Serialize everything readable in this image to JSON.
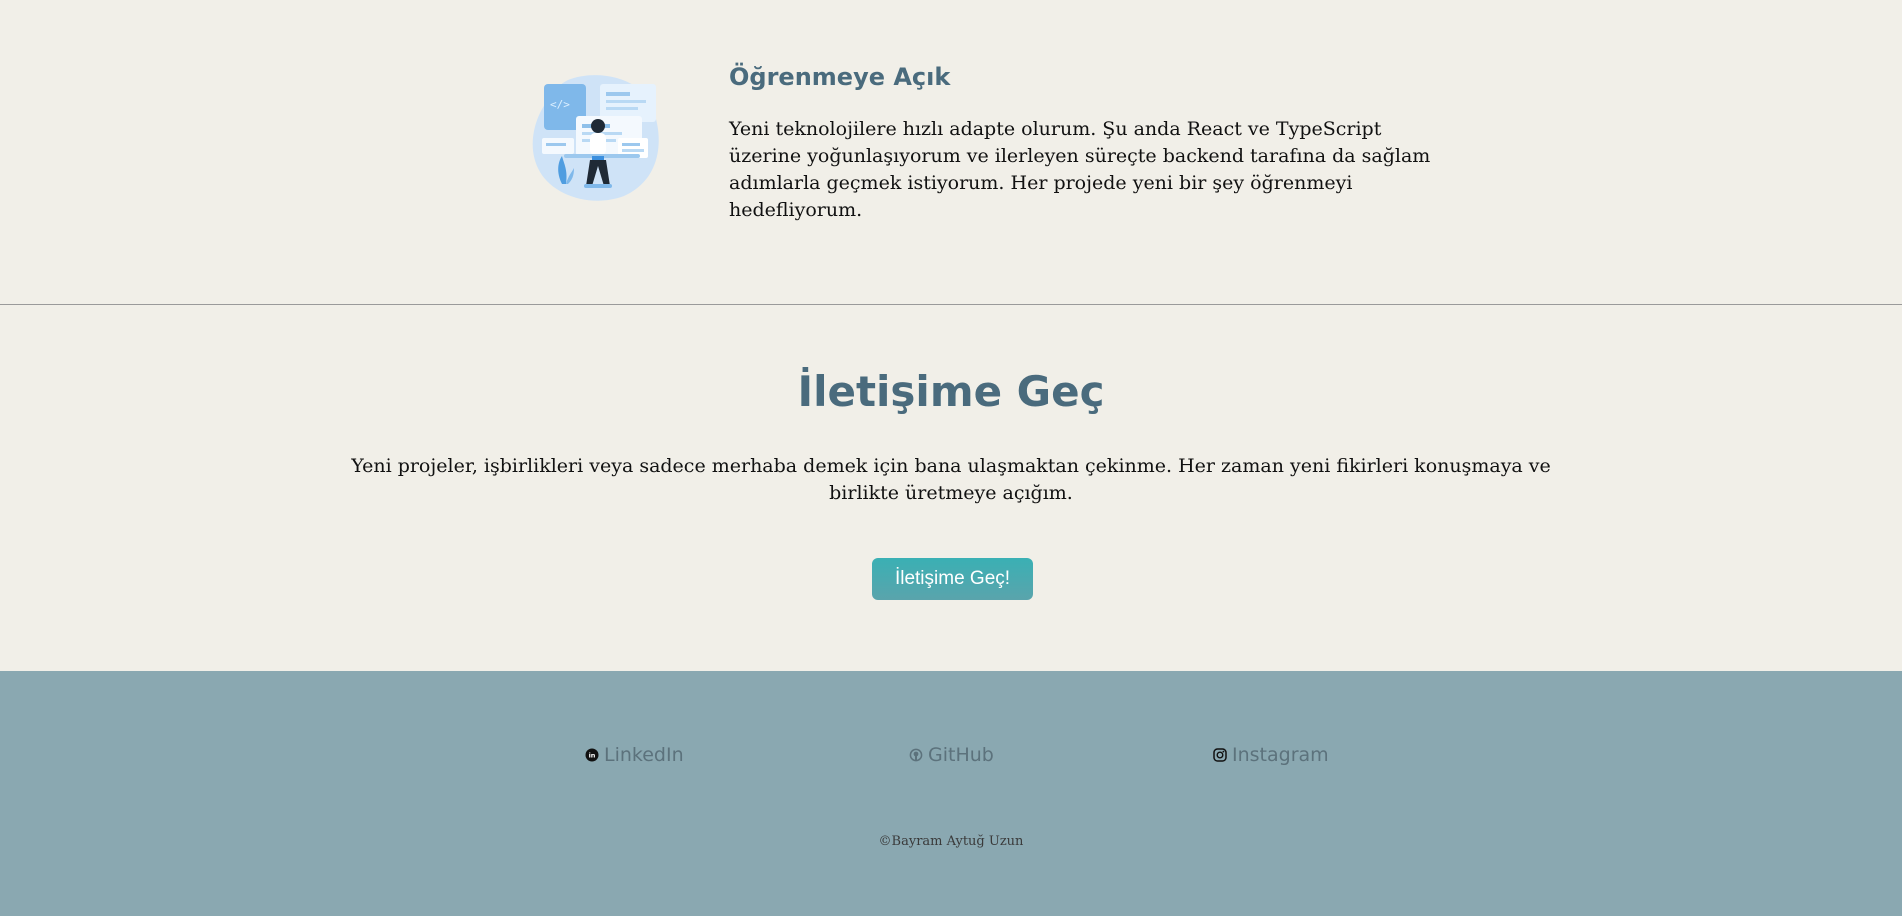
{
  "feature": {
    "title": "Öğrenmeye Açık",
    "text": "Yeni teknolojilere hızlı adapte olurum. Şu anda React ve TypeScript üzerine yoğunlaşıyorum ve ilerleyen süreçte backend tarafına da sağlam adımlarla geçmek istiyorum. Her projede yeni bir şey öğrenmeyi hedefliyorum."
  },
  "contact": {
    "title": "İletişime Geç",
    "text": "Yeni projeler, işbirlikleri veya sadece merhaba demek için bana ulaşmaktan çekinme. Her zaman yeni fikirleri konuşmaya ve birlikte üretmeye açığım.",
    "button_label": "İletişime Geç!"
  },
  "footer": {
    "links": [
      {
        "label": "LinkedIn",
        "icon": "linkedin-icon"
      },
      {
        "label": "GitHub",
        "icon": "github-icon"
      },
      {
        "label": "Instagram",
        "icon": "instagram-icon"
      }
    ],
    "copyright": "©Bayram Aytuğ Uzun"
  },
  "colors": {
    "background": "#f1efe8",
    "heading": "#4a6b7d",
    "button": "#3ab0b4",
    "footer": "#8aa8b1",
    "footer_link": "#5c727c"
  }
}
